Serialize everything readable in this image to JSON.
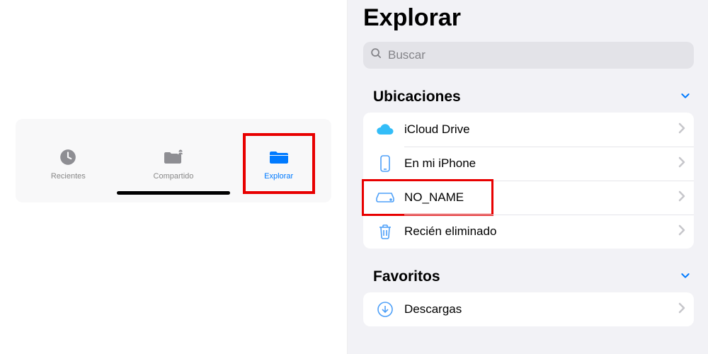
{
  "tabs": {
    "recent": {
      "label": "Recientes"
    },
    "shared": {
      "label": "Compartido"
    },
    "browse": {
      "label": "Explorar"
    }
  },
  "browse": {
    "title": "Explorar",
    "search_placeholder": "Buscar",
    "sections": {
      "locations": {
        "name": "Ubicaciones",
        "items": {
          "icloud": {
            "label": "iCloud Drive"
          },
          "iphone": {
            "label": "En mi iPhone"
          },
          "noname": {
            "label": "NO_NAME"
          },
          "deleted": {
            "label": "Recién eliminado"
          }
        }
      },
      "favorites": {
        "name": "Favoritos",
        "items": {
          "downloads": {
            "label": "Descargas"
          }
        }
      }
    }
  }
}
